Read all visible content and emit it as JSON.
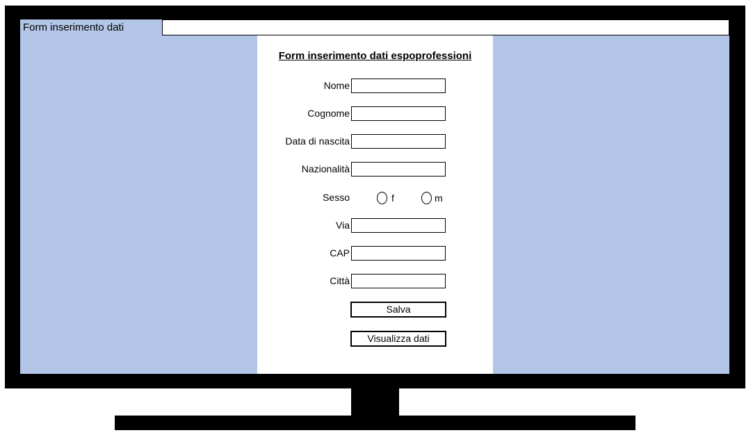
{
  "window": {
    "title": "Form inserimento dati"
  },
  "form": {
    "heading": "Form inserimento dati espoprofessioni",
    "fields": {
      "nome": {
        "label": "Nome",
        "value": ""
      },
      "cognome": {
        "label": "Cognome",
        "value": ""
      },
      "data_nascita": {
        "label": "Data di nascita",
        "value": ""
      },
      "nazionalita": {
        "label": "Nazionalità",
        "value": ""
      },
      "via": {
        "label": "Via",
        "value": ""
      },
      "cap": {
        "label": "CAP",
        "value": ""
      },
      "citta": {
        "label": "Città",
        "value": ""
      }
    },
    "sesso": {
      "label": "Sesso",
      "options": [
        "f",
        "m"
      ],
      "selected": ""
    },
    "buttons": {
      "save": "Salva",
      "view": "Visualizza dati"
    }
  },
  "colors": {
    "screen_background": "#b4c6e7",
    "monitor": "#000000",
    "panel": "#ffffff"
  }
}
